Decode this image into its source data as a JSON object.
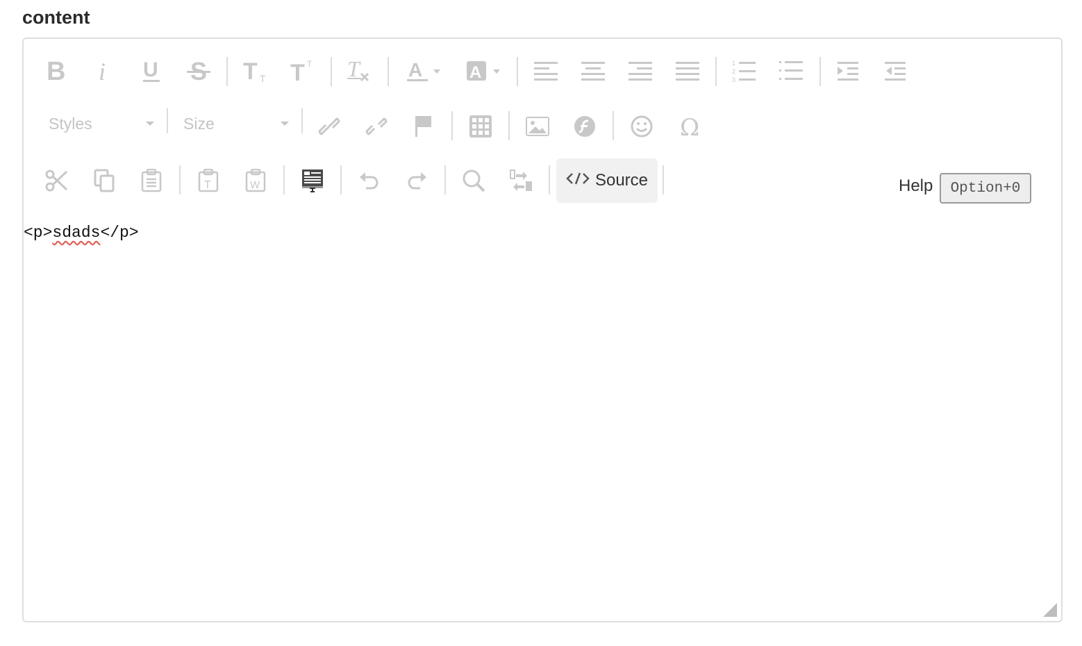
{
  "field": {
    "label": "content"
  },
  "toolbar": {
    "row1": [
      {
        "name": "bold-button",
        "icon": "bold-icon",
        "title": "Bold"
      },
      {
        "name": "italic-button",
        "icon": "italic-icon",
        "title": "Italic"
      },
      {
        "name": "underline-button",
        "icon": "underline-icon",
        "title": "Underline"
      },
      {
        "name": "strikethrough-button",
        "icon": "strikethrough-icon",
        "title": "Strikethrough"
      },
      {
        "name": "subscript-button",
        "icon": "subscript-icon",
        "title": "Subscript"
      },
      {
        "name": "superscript-button",
        "icon": "superscript-icon",
        "title": "Superscript"
      },
      {
        "name": "remove-format-button",
        "icon": "remove-format-icon",
        "title": "Remove Format"
      },
      {
        "name": "text-color-button",
        "icon": "text-color-icon",
        "title": "Text Color"
      },
      {
        "name": "background-color-button",
        "icon": "background-color-icon",
        "title": "Background Color"
      },
      {
        "name": "align-left-button",
        "icon": "align-left-icon",
        "title": "Align Left"
      },
      {
        "name": "align-center-button",
        "icon": "align-center-icon",
        "title": "Center"
      },
      {
        "name": "align-right-button",
        "icon": "align-right-icon",
        "title": "Align Right"
      },
      {
        "name": "justify-button",
        "icon": "justify-icon",
        "title": "Justify"
      },
      {
        "name": "numbered-list-button",
        "icon": "numbered-list-icon",
        "title": "Numbered List"
      },
      {
        "name": "bulleted-list-button",
        "icon": "bulleted-list-icon",
        "title": "Bulleted List"
      },
      {
        "name": "indent-button",
        "icon": "indent-icon",
        "title": "Increase Indent"
      },
      {
        "name": "outdent-button",
        "icon": "outdent-icon",
        "title": "Decrease Indent"
      }
    ],
    "styles_combo": "Styles",
    "size_combo": "Size",
    "row2": [
      {
        "name": "link-button",
        "icon": "link-icon"
      },
      {
        "name": "unlink-button",
        "icon": "unlink-icon"
      },
      {
        "name": "anchor-button",
        "icon": "flag-icon"
      },
      {
        "name": "table-button",
        "icon": "table-icon"
      },
      {
        "name": "image-button",
        "icon": "image-icon"
      },
      {
        "name": "flash-button",
        "icon": "flash-icon"
      },
      {
        "name": "smiley-button",
        "icon": "smiley-icon"
      },
      {
        "name": "special-char-button",
        "icon": "omega-icon"
      }
    ],
    "row3": [
      {
        "name": "cut-button",
        "icon": "scissors-icon"
      },
      {
        "name": "copy-button",
        "icon": "copy-icon"
      },
      {
        "name": "paste-button",
        "icon": "paste-icon"
      },
      {
        "name": "paste-text-button",
        "icon": "paste-text-icon"
      },
      {
        "name": "paste-word-button",
        "icon": "paste-word-icon"
      },
      {
        "name": "templates-button",
        "icon": "templates-icon"
      },
      {
        "name": "undo-button",
        "icon": "undo-icon"
      },
      {
        "name": "redo-button",
        "icon": "redo-icon"
      },
      {
        "name": "find-button",
        "icon": "search-icon"
      },
      {
        "name": "replace-button",
        "icon": "replace-icon"
      }
    ],
    "source_label": "Source",
    "help_label": "Help",
    "help_shortcut": "Option+0"
  },
  "source": {
    "open_tag": "<p>",
    "text": "sdads",
    "close_tag": "</p>"
  }
}
